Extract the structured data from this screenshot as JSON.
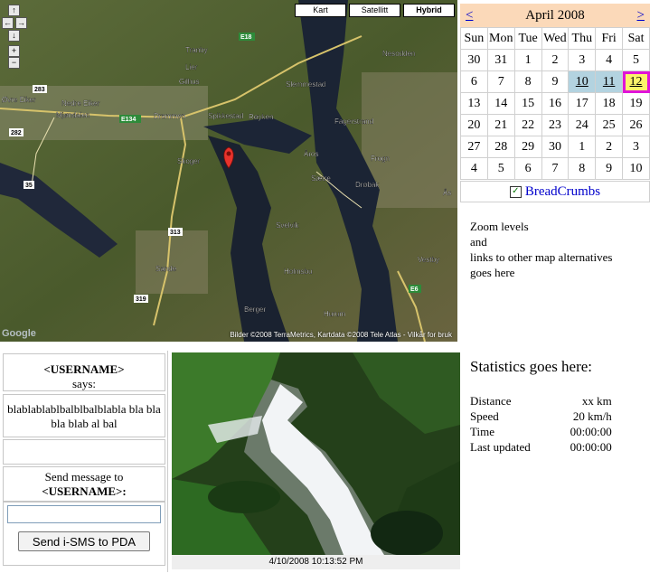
{
  "map": {
    "types": [
      "Kart",
      "Satellitt",
      "Hybrid"
    ],
    "active_type": "Hybrid",
    "nav_arrows": {
      "up": "↑",
      "left": "←",
      "right": "→",
      "down": "↓",
      "zoom_in": "+",
      "zoom_out": "−"
    },
    "attribution": "Bilder ©2008 TerraMetrics, Kartdata ©2008 Tele Atlas - Vilkår for bruk",
    "logo": "Google",
    "places": [
      "Tranby",
      "Lier",
      "Øvre Eiker",
      "Nedre Eiker",
      "Mjøndalen",
      "Drammen",
      "Spikkestad",
      "Røyken",
      "Slemmestad",
      "Fagerstrand",
      "Nesodden",
      "Skoger",
      "Frogn",
      "Drøbak",
      "Åros",
      "Sætre",
      "Svelvik",
      "Holmsbu",
      "Sande",
      "Berger",
      "Hurum",
      "Vestby",
      "Gilhus",
      "Ås"
    ],
    "roads": [
      "E18",
      "E134",
      "283",
      "282",
      "35",
      "313",
      "319",
      "E6"
    ],
    "marker_color": "#e8332c"
  },
  "calendar": {
    "prev": "<",
    "next": ">",
    "month": "April 2008",
    "weekdays": [
      "Sun",
      "Mon",
      "Tue",
      "Wed",
      "Thu",
      "Fri",
      "Sat"
    ],
    "weeks": [
      [
        "30",
        "31",
        "1",
        "2",
        "3",
        "4",
        "5"
      ],
      [
        "6",
        "7",
        "8",
        "9",
        "10",
        "11",
        "12"
      ],
      [
        "13",
        "14",
        "15",
        "16",
        "17",
        "18",
        "19"
      ],
      [
        "20",
        "21",
        "22",
        "23",
        "24",
        "25",
        "26"
      ],
      [
        "27",
        "28",
        "29",
        "30",
        "1",
        "2",
        "3"
      ],
      [
        "4",
        "5",
        "6",
        "7",
        "8",
        "9",
        "10"
      ]
    ],
    "selected": [
      "10",
      "11"
    ],
    "today": "12",
    "breadcrumbs_label": "BreadCrumbs",
    "breadcrumbs_checked": true
  },
  "zoom_note": [
    "Zoom levels",
    "and",
    "links to other map alternatives",
    "goes here"
  ],
  "chat": {
    "username": "<USERNAME>",
    "says": "says:",
    "message": "blablablablbalblbalblabla bla bla bla blab al bal",
    "send_to_prefix": "Send message to",
    "send_to_user": "<USERNAME>:",
    "input_value": "",
    "button_label": "Send i-SMS to PDA"
  },
  "photo": {
    "timestamp": "4/10/2008 10:13:52 PM"
  },
  "stats": {
    "title": "Statistics goes here:",
    "rows": [
      {
        "label": "Distance",
        "value": "xx km"
      },
      {
        "label": "Speed",
        "value": "20 km/h"
      },
      {
        "label": "Time",
        "value": "00:00:00"
      },
      {
        "label": "Last updated",
        "value": "00:00:00"
      }
    ]
  }
}
